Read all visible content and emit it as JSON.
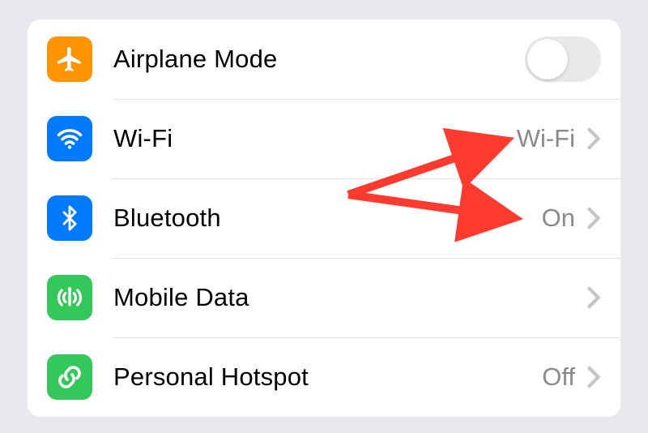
{
  "rows": [
    {
      "key": "airplane",
      "label": "Airplane Mode",
      "value": null,
      "toggle": true,
      "chevron": false
    },
    {
      "key": "wifi",
      "label": "Wi-Fi",
      "value": "Wi-Fi",
      "toggle": false,
      "chevron": true
    },
    {
      "key": "bluetooth",
      "label": "Bluetooth",
      "value": "On",
      "toggle": false,
      "chevron": true
    },
    {
      "key": "mobile",
      "label": "Mobile Data",
      "value": null,
      "toggle": false,
      "chevron": true
    },
    {
      "key": "hotspot",
      "label": "Personal Hotspot",
      "value": "Off",
      "toggle": false,
      "chevron": true
    }
  ],
  "annotation": {
    "color": "#ff3a2f"
  }
}
